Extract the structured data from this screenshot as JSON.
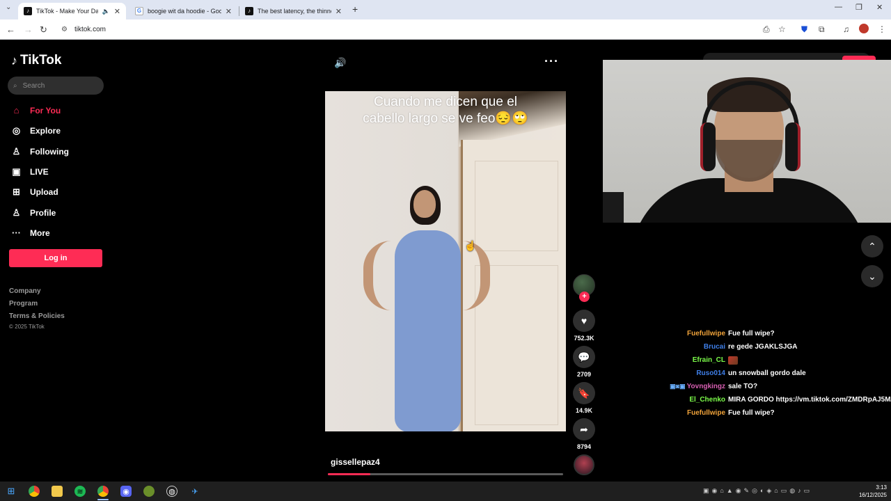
{
  "browser": {
    "tabs": [
      {
        "title": "TikTok - Make Your Day",
        "active": true
      },
      {
        "title": "boogie wit da hoodie - Google"
      },
      {
        "title": "The best latency, the thinnest, a"
      }
    ],
    "new_tab": "+",
    "url": "tiktok.com"
  },
  "sidebar": {
    "logo": "TikTok",
    "search_placeholder": "Search",
    "nav": [
      {
        "label": "For You",
        "icon": "home-icon",
        "active": true
      },
      {
        "label": "Explore",
        "icon": "compass-icon"
      },
      {
        "label": "Following",
        "icon": "user-icon"
      },
      {
        "label": "LIVE",
        "icon": "live-icon"
      },
      {
        "label": "Upload",
        "icon": "upload-icon"
      },
      {
        "label": "Profile",
        "icon": "profile-icon"
      },
      {
        "label": "More",
        "icon": "more-icon"
      }
    ],
    "login": "Log in",
    "footer": [
      "Company",
      "Program",
      "Terms & Policies"
    ],
    "copyright": "© 2025 TikTok"
  },
  "video": {
    "caption_line1": "Cuando me dicen que el",
    "caption_line2": "cabello largo se ve feo😔🙄",
    "creator": "gissellepaz4",
    "progress": 0.18
  },
  "actions": {
    "likes": "752.3K",
    "comments": "2709",
    "saves": "14.9K",
    "shares": "8794",
    "follow": "+"
  },
  "chat": [
    {
      "user": "Fuefullwipe",
      "color": "#f0a33a",
      "msg": "Fue full wipe?"
    },
    {
      "user": "Brucai",
      "color": "#3f7fe8",
      "msg": "re gede JGAKLSJGA"
    },
    {
      "user": "Efrain_CL",
      "color": "#7cfc4a",
      "msg": "",
      "emote": true
    },
    {
      "user": "Ruso014",
      "color": "#3f7fe8",
      "msg": "un snowball gordo dale"
    },
    {
      "user": "Yovngkingz",
      "color": "#d85fb2",
      "msg": "sale TO?",
      "badges": "▣◙▣"
    },
    {
      "user": "El_Chenko",
      "color": "#7cfc4a",
      "msg": "MIRA GORDO https://vm.tiktok.com/ZMDRpAJ5M/"
    },
    {
      "user": "Fuefullwipe",
      "color": "#f0a33a",
      "msg": "Fue full wipe?"
    }
  ],
  "taskbar": {
    "time": "3:13",
    "date": "16/12/2025"
  },
  "colors": {
    "accent": "#fe2c55",
    "background": "#000000"
  }
}
